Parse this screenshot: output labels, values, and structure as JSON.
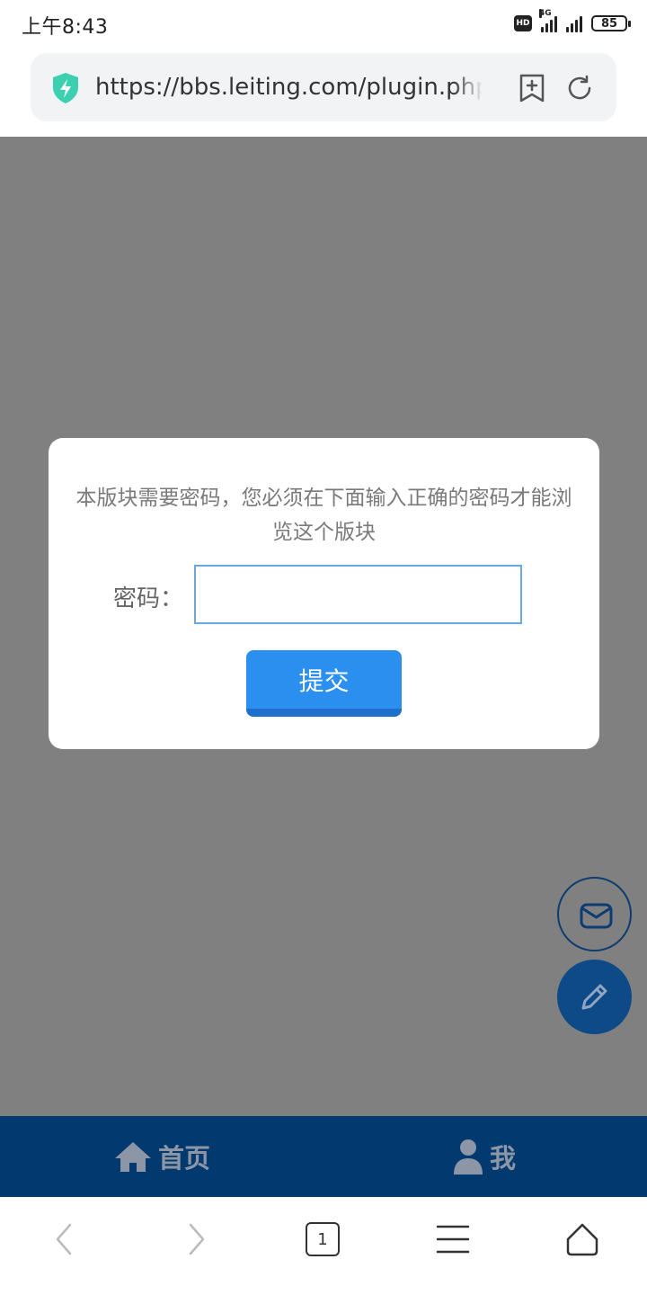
{
  "status_bar": {
    "time": "上午8:43",
    "hd_label": "HD",
    "network_label": "4G",
    "battery": "85"
  },
  "address_bar": {
    "url": "https://bbs.leiting.com/plugin.php",
    "secure_icon": "shield-bolt-icon",
    "accent_color": "#3ccfb0"
  },
  "dialog": {
    "message": "本版块需要密码，您必须在下面输入正确的密码才能浏览这个版块",
    "password_label": "密码：",
    "password_value": "",
    "submit_label": "提交"
  },
  "fabs": {
    "mail_icon": "envelope-icon",
    "edit_icon": "pencil-icon"
  },
  "site_nav": {
    "items": [
      {
        "label": "首页",
        "icon": "home-icon"
      },
      {
        "label": "我",
        "icon": "user-icon"
      }
    ]
  },
  "browser_toolbar": {
    "tab_count": "1"
  },
  "colors": {
    "overlay": "#808080",
    "nav_bg": "#02396e",
    "button": "#2b8ff0"
  }
}
